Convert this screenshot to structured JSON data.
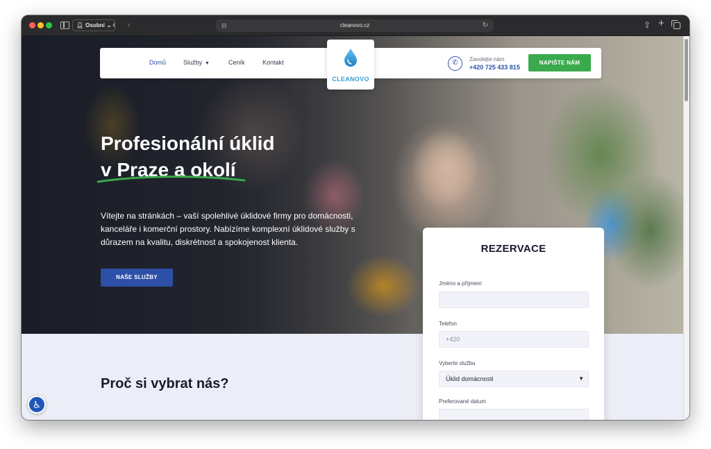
{
  "browser": {
    "profile_label": "Osobní",
    "profile_chevron": "⌄",
    "url": "cleanovo.cz",
    "back_icon": "‹",
    "forward_icon": "›",
    "reload_icon": "↻",
    "share_icon": "⇪",
    "new_tab_icon": "+"
  },
  "header": {
    "nav": [
      {
        "label": "Domů"
      },
      {
        "label": "Služby"
      },
      {
        "label": "Ceník"
      },
      {
        "label": "Kontakt"
      }
    ],
    "logo_text": "CLEANOVO",
    "phone_label": "Zavolejte nám",
    "phone_number": "+420 725 433 815",
    "phone_icon": "✆",
    "cta_label": "NAPIŠTE NÁM"
  },
  "hero": {
    "title_line1": "Profesionální úklid",
    "title_line2": "v Praze a okolí",
    "text": "Vítejte na stránkách – vaší spolehlivé úklidové firmy pro domácnosti, kanceláře i komerční prostory. Nabízíme komplexní úklidové služby s důrazem na kvalitu, diskrétnost a spokojenost klienta.",
    "button_label": "NAŠE SLUŽBY"
  },
  "why": {
    "title": "Proč si vybrat nás?"
  },
  "reservation": {
    "title": "REZERVACE",
    "name_label": "Jméno a příjmení",
    "name_value": "",
    "phone_label": "Telefon",
    "phone_placeholder": "+420",
    "service_label": "Vyberte službu",
    "service_selected": "Úklid domácnosti",
    "date_label": "Preferované datum",
    "date_value": ""
  },
  "colors": {
    "primary_blue": "#2d4fa8",
    "green": "#3aaa4c",
    "logo_blue": "#3aa0d8",
    "section_bg": "#eceef7"
  },
  "icons": {
    "accessibility": "accessibility-icon"
  }
}
